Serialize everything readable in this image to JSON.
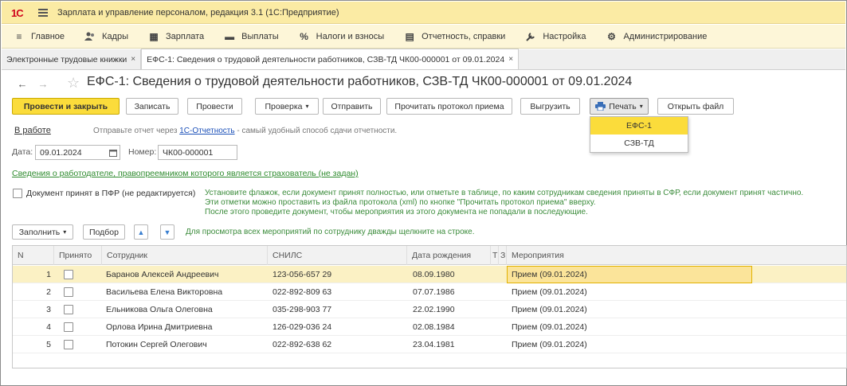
{
  "app": {
    "logo_text": "1С",
    "title": "Зарплата и управление персоналом, редакция 3.1  (1С:Предприятие)"
  },
  "menu": [
    {
      "label": "Главное",
      "icon": "hamburger-icon",
      "glyph": "≡"
    },
    {
      "label": "Кадры",
      "icon": "users-icon",
      "glyph": "👥"
    },
    {
      "label": "Зарплата",
      "icon": "calculator-icon",
      "glyph": "▦"
    },
    {
      "label": "Выплаты",
      "icon": "money-icon",
      "glyph": "▬"
    },
    {
      "label": "Налоги и взносы",
      "icon": "percent-icon",
      "glyph": "%"
    },
    {
      "label": "Отчетность, справки",
      "icon": "report-icon",
      "glyph": "▤"
    },
    {
      "label": "Настройка",
      "icon": "wrench-icon",
      "glyph": "🔧"
    },
    {
      "label": "Администрирование",
      "icon": "gear-icon",
      "glyph": "⚙"
    }
  ],
  "tabs": [
    {
      "label": "Электронные трудовые книжки",
      "close": "×"
    },
    {
      "label": "ЕФС-1: Сведения о трудовой деятельности работников, СЗВ-ТД ЧК00-000001 от 09.01.2024",
      "close": "×"
    }
  ],
  "header": {
    "back": "←",
    "forward": "→",
    "star": "☆",
    "title": "ЕФС-1: Сведения о трудовой деятельности работников, СЗВ-ТД ЧК00-000001 от 09.01.2024"
  },
  "toolbar": {
    "post_close": "Провести и закрыть",
    "save": "Записать",
    "post": "Провести",
    "check": "Проверка",
    "send": "Отправить",
    "read_protocol": "Прочитать протокол приема",
    "export": "Выгрузить",
    "print": "Печать",
    "open_file": "Открыть файл",
    "caret": "▾"
  },
  "print_menu": [
    "ЕФС-1",
    "СЗВ-ТД"
  ],
  "status": {
    "state": "В работе",
    "hint_before": "Отправьте отчет через ",
    "hint_link": "1С-Отчетность",
    "hint_after": " - самый удобный способ сдачи отчетности."
  },
  "form": {
    "date_label": "Дата:",
    "date_value": "09.01.2024",
    "number_label": "Номер:",
    "number_value": "ЧК00-000001",
    "employer_link": "Сведения о работодателе, правопреемником которого является страхователь (не задан)",
    "accepted_label": "Документ принят в ПФР (не редактируется)",
    "accepted_note": [
      "Установите флажок, если документ принят полностью, или отметьте в таблице, по каким сотрудникам сведения приняты в СФР, если документ принят частично.",
      "Эти отметки можно проставить из файла протокола (xml) по кнопке \"Прочитать протокол приема\" вверху.",
      "После этого проведите документ, чтобы мероприятия из этого документа не попадали в последующие."
    ]
  },
  "table_toolbar": {
    "fill": "Заполнить",
    "select": "Подбор",
    "up": "▲",
    "down": "▼",
    "hint": "Для просмотра всех мероприятий по сотруднику дважды щелкните на строке."
  },
  "table": {
    "columns": [
      "N",
      "Принято",
      "Сотрудник",
      "СНИЛС",
      "Дата рождения",
      "Т",
      "З",
      "Мероприятия"
    ],
    "rows": [
      {
        "n": "1",
        "employee": "Баранов Алексей Андреевич",
        "snils": "123-056-657 29",
        "birth": "08.09.1980",
        "event": "Прием (09.01.2024)"
      },
      {
        "n": "2",
        "employee": "Васильева Елена Викторовна",
        "snils": "022-892-809 63",
        "birth": "07.07.1986",
        "event": "Прием (09.01.2024)"
      },
      {
        "n": "3",
        "employee": "Ельникова Ольга Олеговна",
        "snils": "035-298-903 77",
        "birth": "22.02.1990",
        "event": "Прием (09.01.2024)"
      },
      {
        "n": "4",
        "employee": "Орлова Ирина Дмитриевна",
        "snils": "126-029-036 24",
        "birth": "02.08.1984",
        "event": "Прием (09.01.2024)"
      },
      {
        "n": "5",
        "employee": "Потокин Сергей Олегович",
        "snils": "022-892-638 62",
        "birth": "23.04.1981",
        "event": "Прием (09.01.2024)"
      }
    ]
  },
  "colors": {
    "primary_button": "#fbdc3b",
    "title_bar": "#fbeba4",
    "selected_row": "#fbf1c4",
    "link_green": "#2e8b2e",
    "link_blue": "#1a4fb8"
  }
}
